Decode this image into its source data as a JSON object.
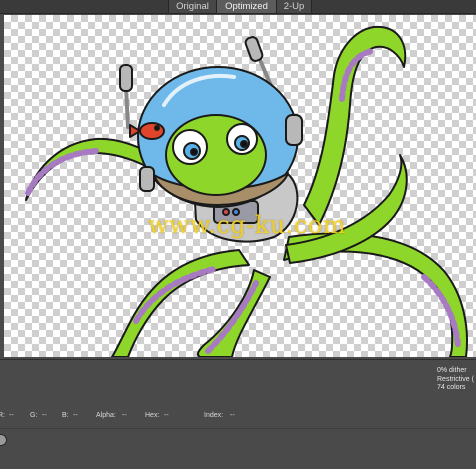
{
  "tabs": [
    {
      "label": "Original"
    },
    {
      "label": "Optimized"
    },
    {
      "label": "2-Up"
    }
  ],
  "canvas": {
    "watermark": "www.cg-ku.com"
  },
  "info": {
    "dither": "0% dither",
    "palette": "Restrictive (",
    "colors": "74 colors"
  },
  "readout": {
    "r_label": "R:",
    "r_value": "--",
    "g_label": "G:",
    "g_value": "--",
    "b_label": "B:",
    "b_value": "--",
    "alpha_label": "Alpha:",
    "alpha_value": "--",
    "hex_label": "Hex:",
    "hex_value": "--",
    "index_label": "Index:",
    "index_value": "--"
  },
  "colors": {
    "tentacle_green": "#8fd62a",
    "sucker_purple": "#a77ac2",
    "helmet_blue": "#6fb9ea",
    "suit_gray": "#c8c8c8",
    "watermark_yellow": "#f2d21a"
  }
}
